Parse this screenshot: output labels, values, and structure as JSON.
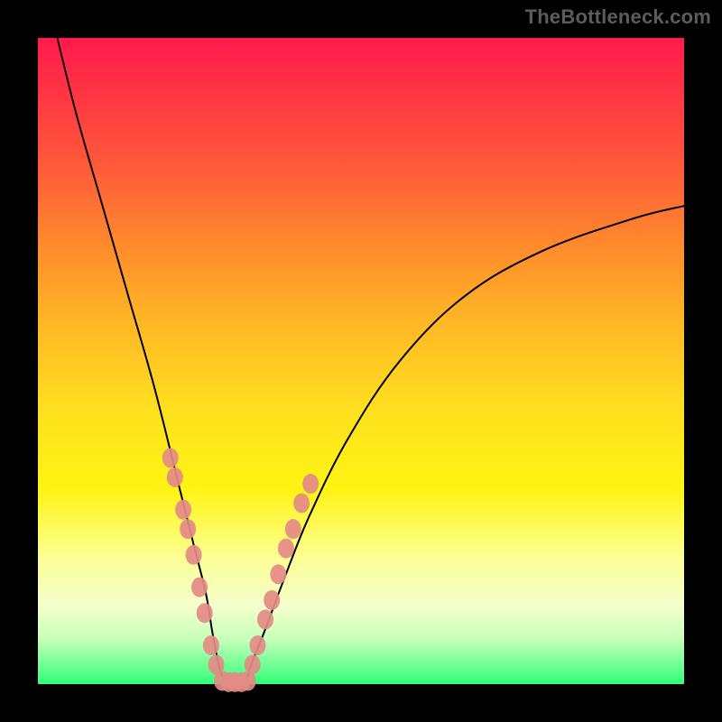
{
  "watermark": "TheBottleneck.com",
  "chart_data": {
    "type": "line",
    "title": "",
    "xlabel": "",
    "ylabel": "",
    "xlim": [
      0,
      100
    ],
    "ylim": [
      0,
      100
    ],
    "grid": false,
    "legend": false,
    "series": [
      {
        "name": "bottleneck-curve",
        "color": "#000000",
        "x": [
          3,
          6,
          10,
          14,
          18,
          22,
          24,
          26,
          27,
          28,
          29,
          30,
          32,
          33,
          35,
          38,
          42,
          48,
          56,
          66,
          78,
          92,
          100
        ],
        "y": [
          100,
          88,
          74,
          60,
          46,
          30,
          22,
          14,
          8,
          3,
          0,
          0,
          0,
          3,
          8,
          16,
          26,
          38,
          50,
          60,
          67,
          72,
          74
        ]
      },
      {
        "name": "highlight-dots-left",
        "color": "#e38b87",
        "type": "scatter",
        "x": [
          20.5,
          21.2,
          22.5,
          23.2,
          24.1,
          25.0,
          25.8,
          26.8,
          27.6
        ],
        "y": [
          35,
          32,
          27,
          24,
          20,
          15,
          11,
          6,
          3
        ]
      },
      {
        "name": "highlight-dots-bottom",
        "color": "#e38b87",
        "type": "scatter",
        "x": [
          28.5,
          29.5,
          30.5,
          31.5,
          32.5
        ],
        "y": [
          0.5,
          0.3,
          0.3,
          0.3,
          0.5
        ]
      },
      {
        "name": "highlight-dots-right",
        "color": "#e38b87",
        "type": "scatter",
        "x": [
          33.2,
          34.0,
          35.2,
          36.2,
          37.2,
          38.4,
          39.5,
          40.8,
          42.2
        ],
        "y": [
          3,
          6,
          10,
          13,
          17,
          21,
          24,
          28,
          31
        ]
      }
    ]
  }
}
